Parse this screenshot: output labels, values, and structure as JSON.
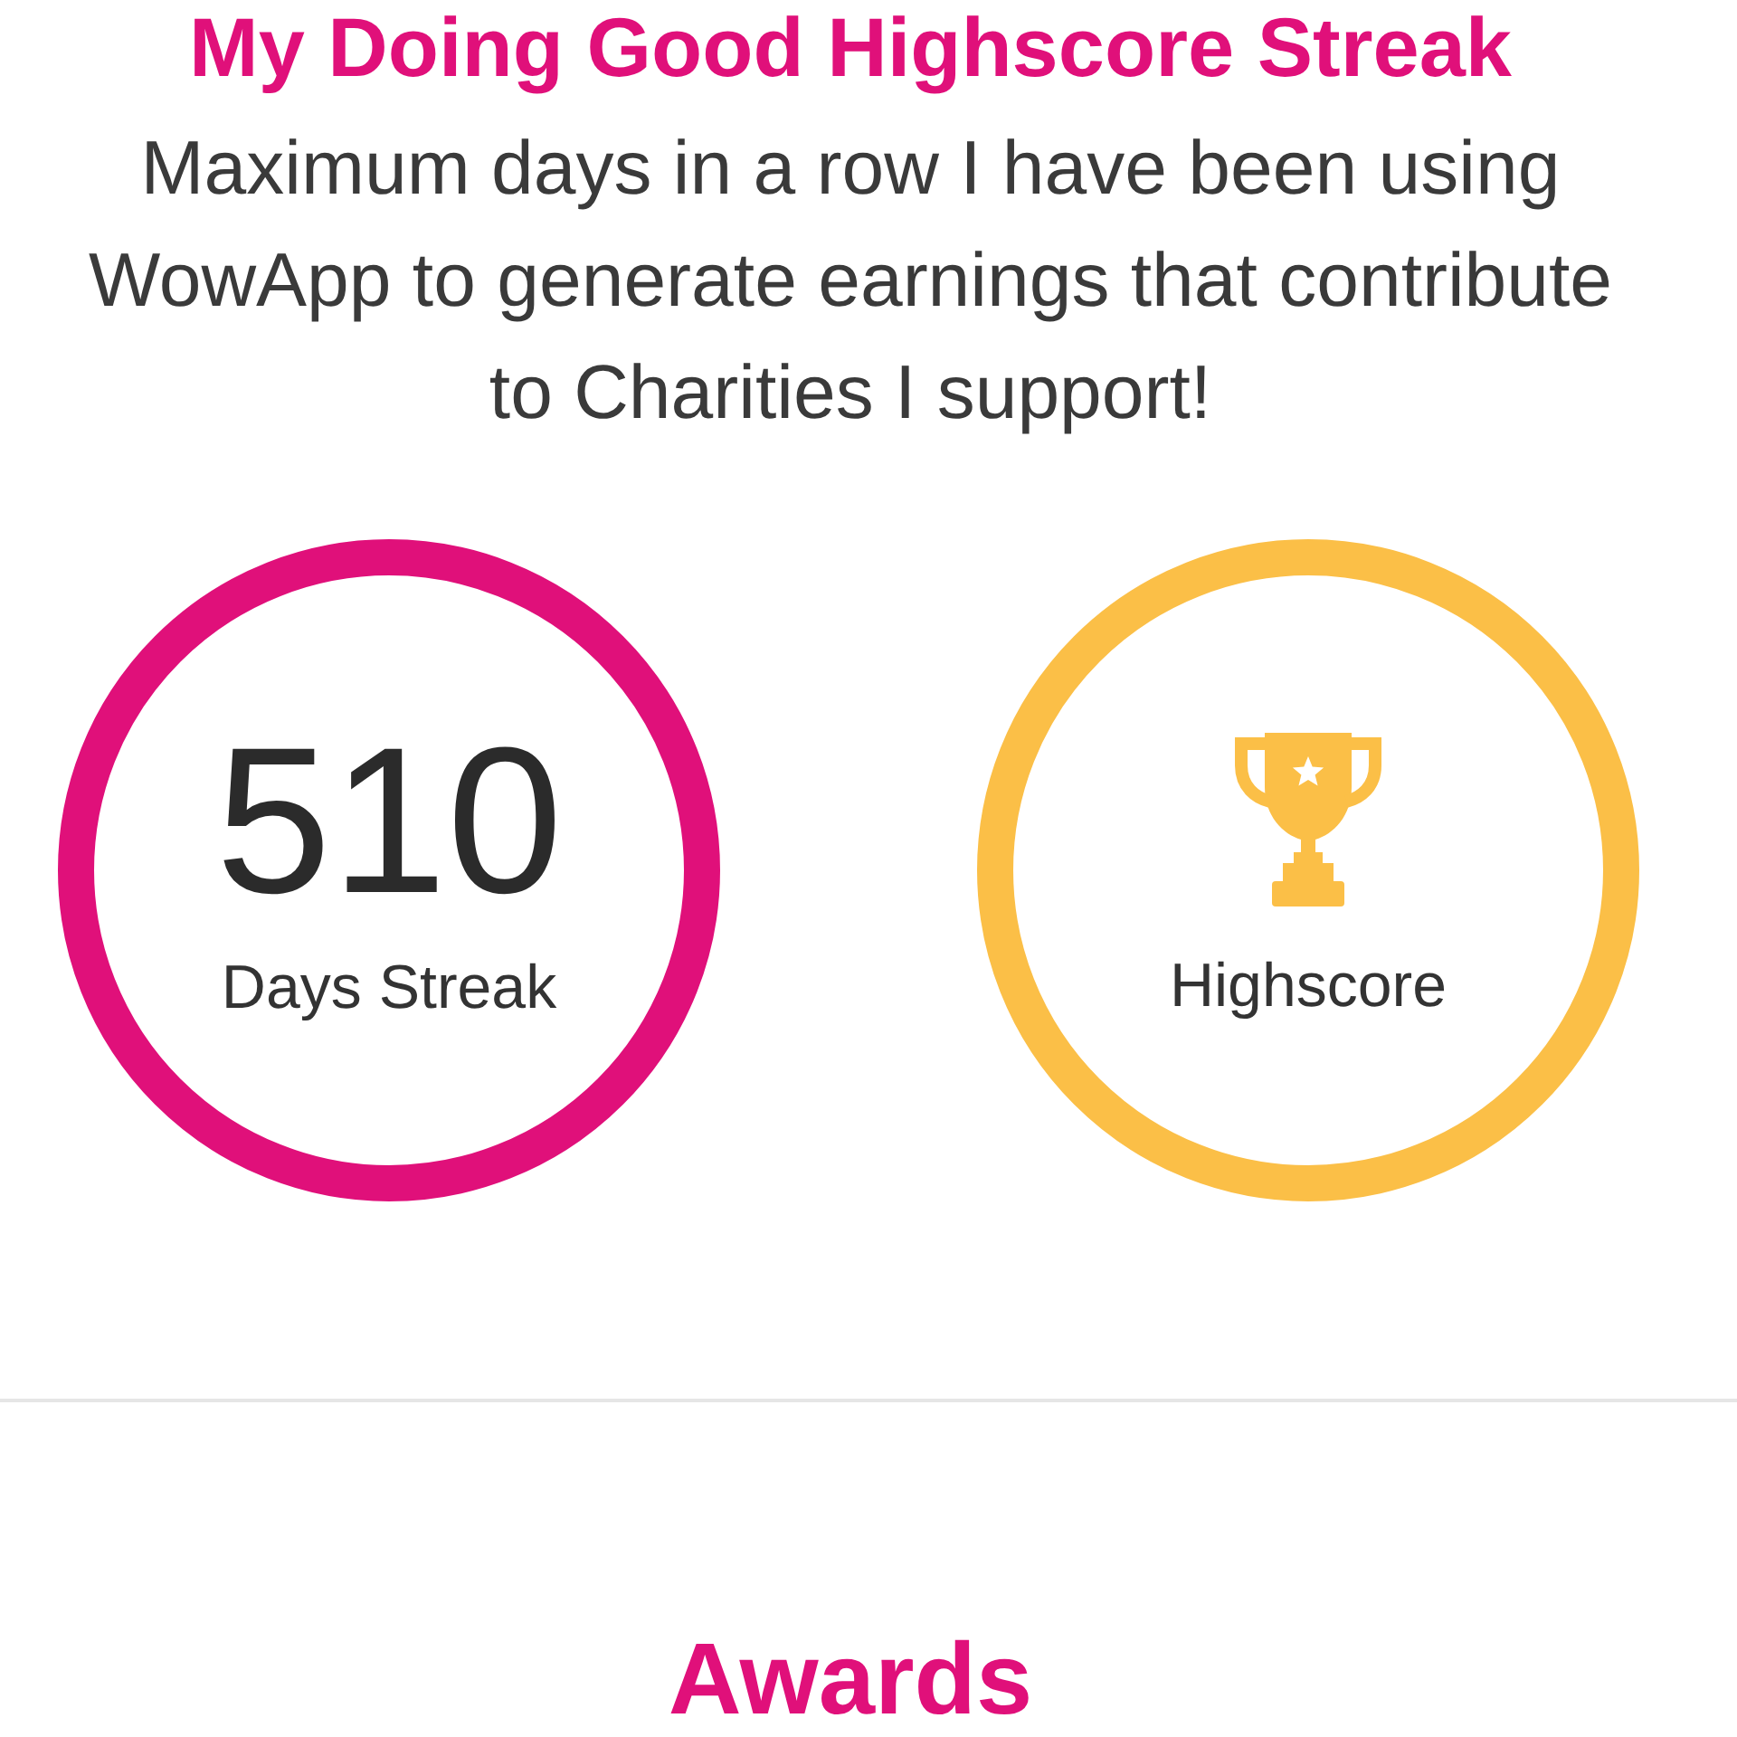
{
  "header": {
    "title": "My Doing Good Highscore Streak",
    "description": "Maximum days in a row I have been using WowApp to generate earnings that contribute to Charities I support!"
  },
  "stats": [
    {
      "kind": "number",
      "value": "510",
      "label": "Days Streak",
      "color": "#e0107a"
    },
    {
      "kind": "trophy",
      "label": "Highscore",
      "color": "#fbbf47"
    }
  ],
  "awards": {
    "title": "Awards"
  }
}
